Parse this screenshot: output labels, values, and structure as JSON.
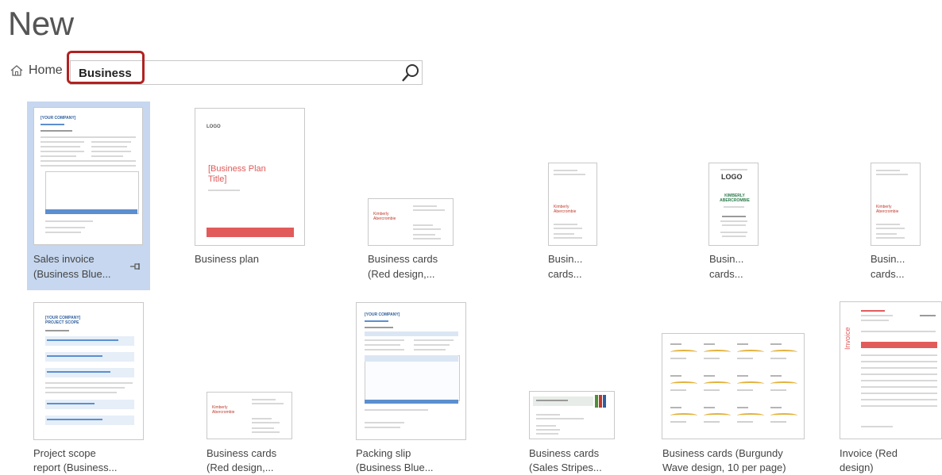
{
  "page": {
    "title": "New"
  },
  "nav": {
    "home_label": "Home"
  },
  "search": {
    "value": "Business"
  },
  "icons": {
    "home": "home-icon",
    "search": "search-icon",
    "pin": "pin-icon"
  },
  "colors": {
    "selection": "#c6d7ef",
    "highlight_box": "#b22222",
    "accent_red": "#e25b5b",
    "accent_blue": "#5b8fcf"
  },
  "templates": [
    {
      "line1": "Sales invoice",
      "line2": "(Business Blue...",
      "selected": true
    },
    {
      "line1": "Business plan",
      "line2": ""
    },
    {
      "line1": "Business cards",
      "line2": "(Red design,..."
    },
    {
      "line1": "Busin...",
      "line2": "cards..."
    },
    {
      "line1": "Busin...",
      "line2": "cards..."
    },
    {
      "line1": "Busin...",
      "line2": "cards..."
    },
    {
      "line1": "Project scope",
      "line2": "report (Business..."
    },
    {
      "line1": "Business cards",
      "line2": "(Red design,..."
    },
    {
      "line1": "Packing slip",
      "line2": "(Business Blue..."
    },
    {
      "line1": "Business cards",
      "line2": "(Sales Stripes..."
    },
    {
      "line1": "Business cards (Burgundy",
      "line2": "Wave design, 10 per page)"
    },
    {
      "line1": "Invoice (Red",
      "line2": "design)"
    }
  ],
  "thumbs": {
    "sales_invoice_header": "[YOUR COMPANY]",
    "business_plan_logo": "LOGO",
    "business_plan_title": "[Business Plan Title]",
    "card_name": "Kimberly Abercrombie",
    "card_logo": "LOGO",
    "card_logo_name": "KIMBERLY ABERCROMBIE",
    "project_header": "[YOUR COMPANY] PROJECT SCOPE",
    "packing_header": "[YOUR COMPANY]",
    "invoice_vertical": "Invoice"
  }
}
